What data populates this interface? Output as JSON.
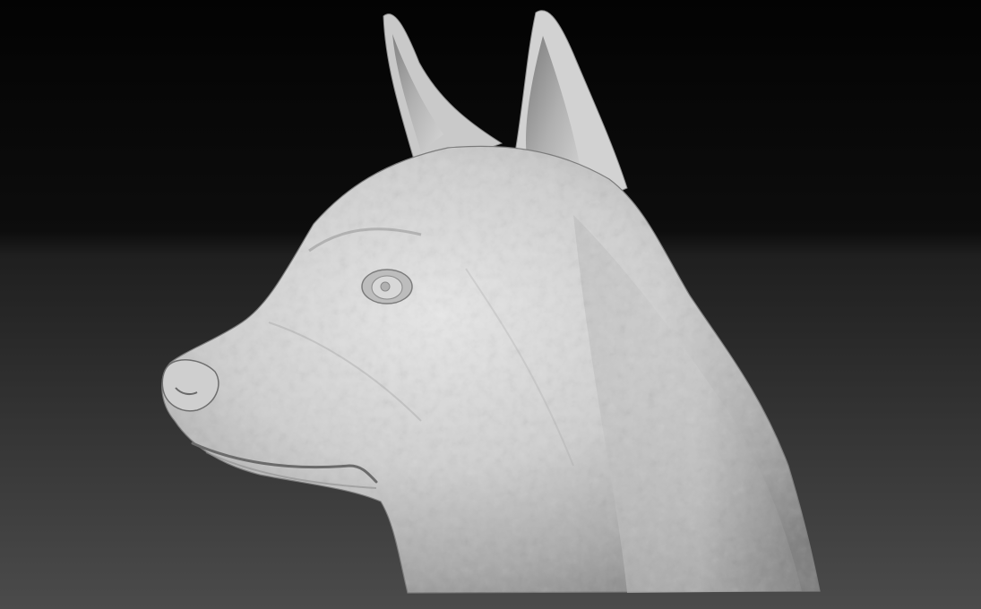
{
  "scene": {
    "subject_icon": "dog-head-sculpt-icon",
    "colors": {
      "background_top": "#030303",
      "background_bottom": "#4b4b4b",
      "model_light": "#e6e6e6",
      "model_mid": "#a9a9a9",
      "model_dark": "#5a5a5a"
    }
  }
}
